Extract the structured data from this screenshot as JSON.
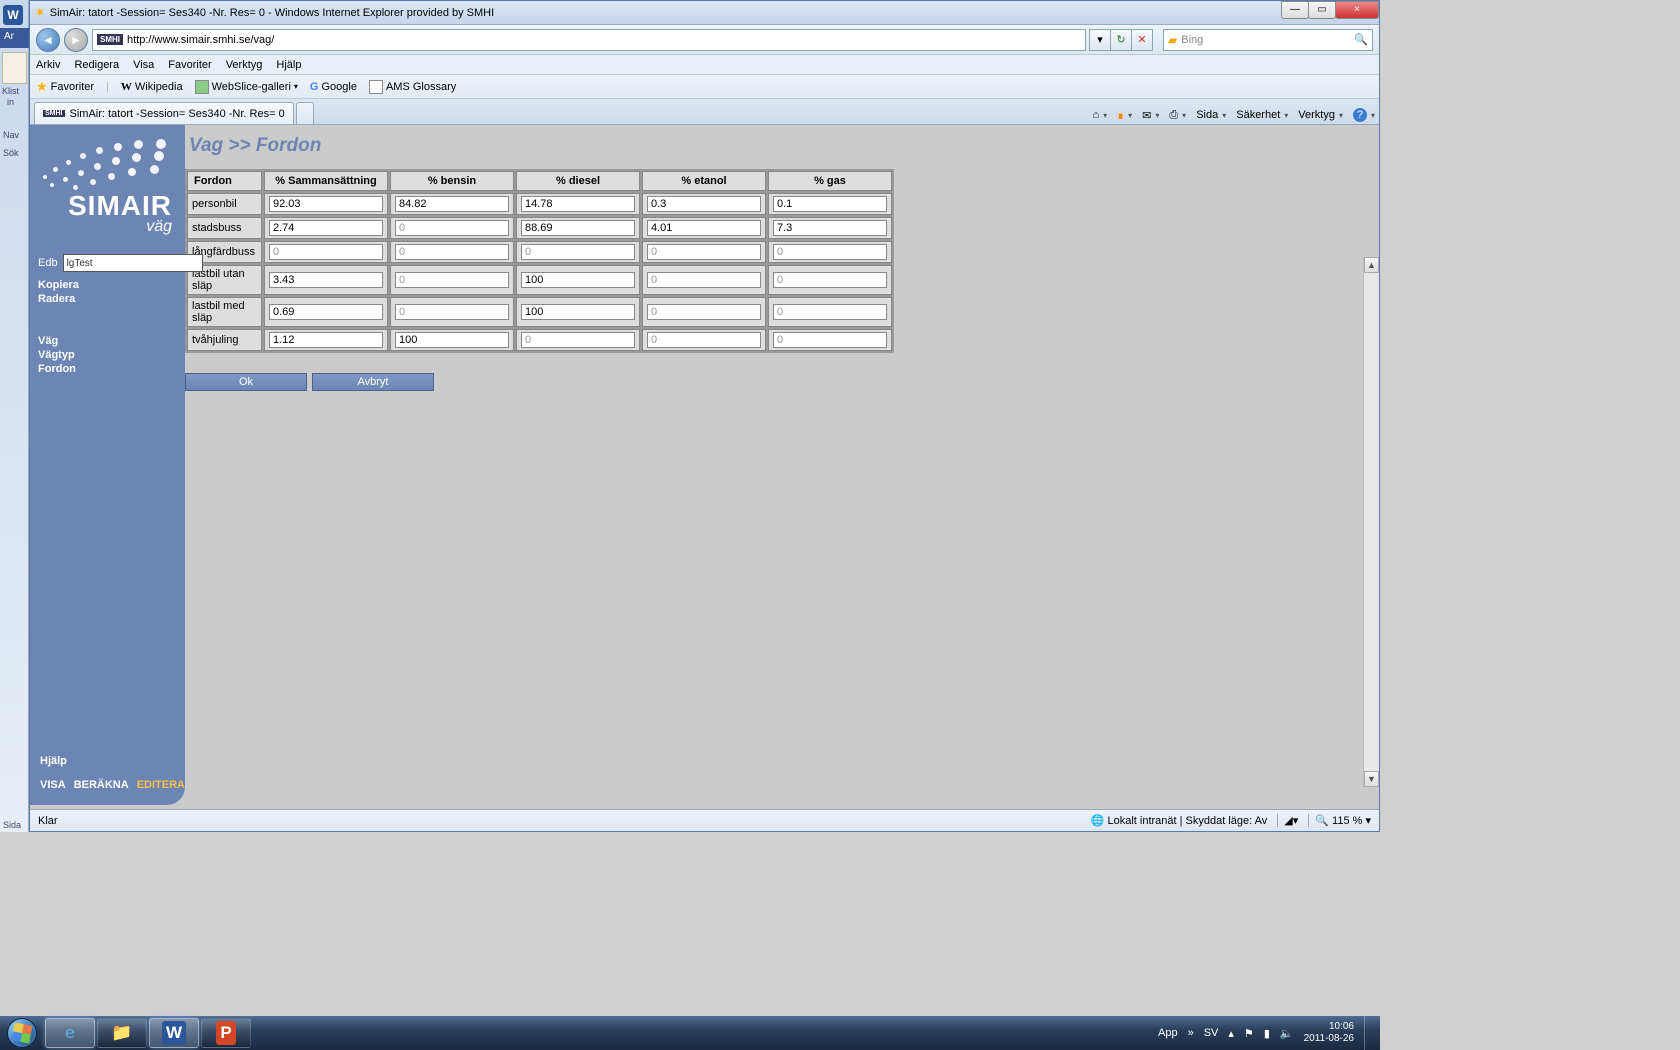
{
  "window": {
    "title": "SimAir: tatort -Session= Ses340 -Nr. Res= 0 - Windows Internet Explorer provided by SMHI",
    "min": "—",
    "max": "▭",
    "close": "×"
  },
  "nav": {
    "url": "http://www.simair.smhi.se/vag/",
    "search_placeholder": "Bing"
  },
  "menu": [
    "Arkiv",
    "Redigera",
    "Visa",
    "Favoriter",
    "Verktyg",
    "Hjälp"
  ],
  "favbar": {
    "label": "Favoriter",
    "items": [
      "Wikipedia",
      "WebSlice-galleri",
      "Google",
      "AMS Glossary"
    ]
  },
  "tab": {
    "label": "SimAir: tatort -Session= Ses340 -Nr. Res= 0"
  },
  "tabtools": {
    "sida": "Sida",
    "sakerhet": "Säkerhet",
    "verktyg": "Verktyg"
  },
  "sidebar": {
    "logo_title": "SIMAIR",
    "logo_sub": "väg",
    "edb_label": "Edb",
    "edb_value": "lgTest",
    "links": [
      "Kopiera",
      "Radera"
    ],
    "nav": [
      "Väg",
      "Vägtyp",
      "Fordon"
    ],
    "help": "Hjälp",
    "modes": {
      "visa": "VISA",
      "berakna": "BERÄKNA",
      "editera": "EDITERA"
    }
  },
  "content": {
    "breadcrumb": "Vag >> Fordon",
    "headers": [
      "Fordon",
      "% Sammansättning",
      "% bensin",
      "% diesel",
      "% etanol",
      "% gas"
    ],
    "rows": [
      {
        "label": "personbil",
        "vals": [
          "92.03",
          "84.82",
          "14.78",
          "0.3",
          "0.1"
        ]
      },
      {
        "label": "stadsbuss",
        "vals": [
          "2.74",
          "0",
          "88.69",
          "4.01",
          "7.3"
        ]
      },
      {
        "label": "långfärdbuss",
        "vals": [
          "0",
          "0",
          "0",
          "0",
          "0"
        ]
      },
      {
        "label": "lastbil utan släp",
        "vals": [
          "3.43",
          "0",
          "100",
          "0",
          "0"
        ]
      },
      {
        "label": "lastbil med släp",
        "vals": [
          "0.69",
          "0",
          "100",
          "0",
          "0"
        ]
      },
      {
        "label": "tvåhjuling",
        "vals": [
          "1.12",
          "100",
          "0",
          "0",
          "0"
        ]
      }
    ],
    "ok": "Ok",
    "cancel": "Avbryt"
  },
  "status": {
    "left": "Klar",
    "sec": "Lokalt intranät | Skyddat läge: Av",
    "zoom": "115 %"
  },
  "left_strip": {
    "tab": "Ar",
    "klistra": "Klist",
    "in": "in",
    "nav": "Nav",
    "sok": "Sök",
    "sida": "Sida"
  },
  "tray": {
    "app": "App",
    "lang": "SV",
    "time": "10:06",
    "date": "2011-08-26"
  }
}
